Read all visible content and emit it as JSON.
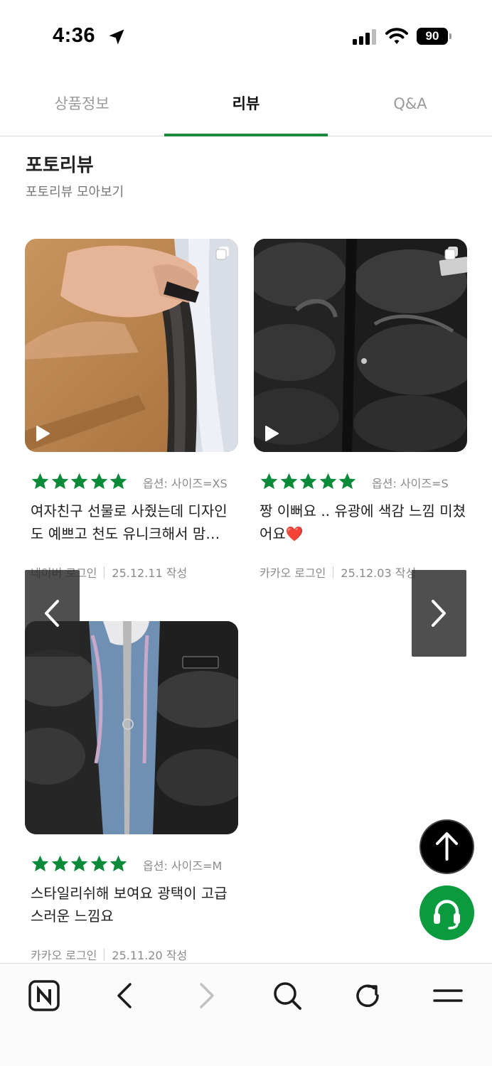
{
  "status_bar": {
    "time": "4:36",
    "battery": "90"
  },
  "tabs": [
    {
      "label": "상품정보",
      "active": false
    },
    {
      "label": "리뷰",
      "active": true
    },
    {
      "label": "Q&A",
      "active": false
    }
  ],
  "accent_color": "#1a8a3c",
  "section": {
    "title": "포토리뷰",
    "subtitle": "포토리뷰 모아보기"
  },
  "reviews": [
    {
      "rating": 5,
      "option": "옵션: 사이즈=XS",
      "text": "여자친구 선물로 사줬는데 디자인도 예쁘고 천도 유니크해서 맘…",
      "login": "네이버 로그인",
      "date": "25.12.11 작성",
      "media": "video"
    },
    {
      "rating": 5,
      "option": "옵션: 사이즈=S",
      "text": "짱 이뻐요 .. 유광에 색감 느낌 미쳤어요❤️",
      "login": "카카오 로그인",
      "date": "25.12.03 작성",
      "media": "video"
    },
    {
      "rating": 5,
      "option": "옵션: 사이즈=M",
      "text": "스타일리쉬해 보여요 광택이 고급스러운 느낌요",
      "login": "카카오 로그인",
      "date": "25.11.20 작성",
      "media": "photo"
    }
  ],
  "toolbar": [
    "naver-home-icon",
    "back-icon",
    "forward-icon",
    "search-icon",
    "reload-icon",
    "menu-icon"
  ]
}
